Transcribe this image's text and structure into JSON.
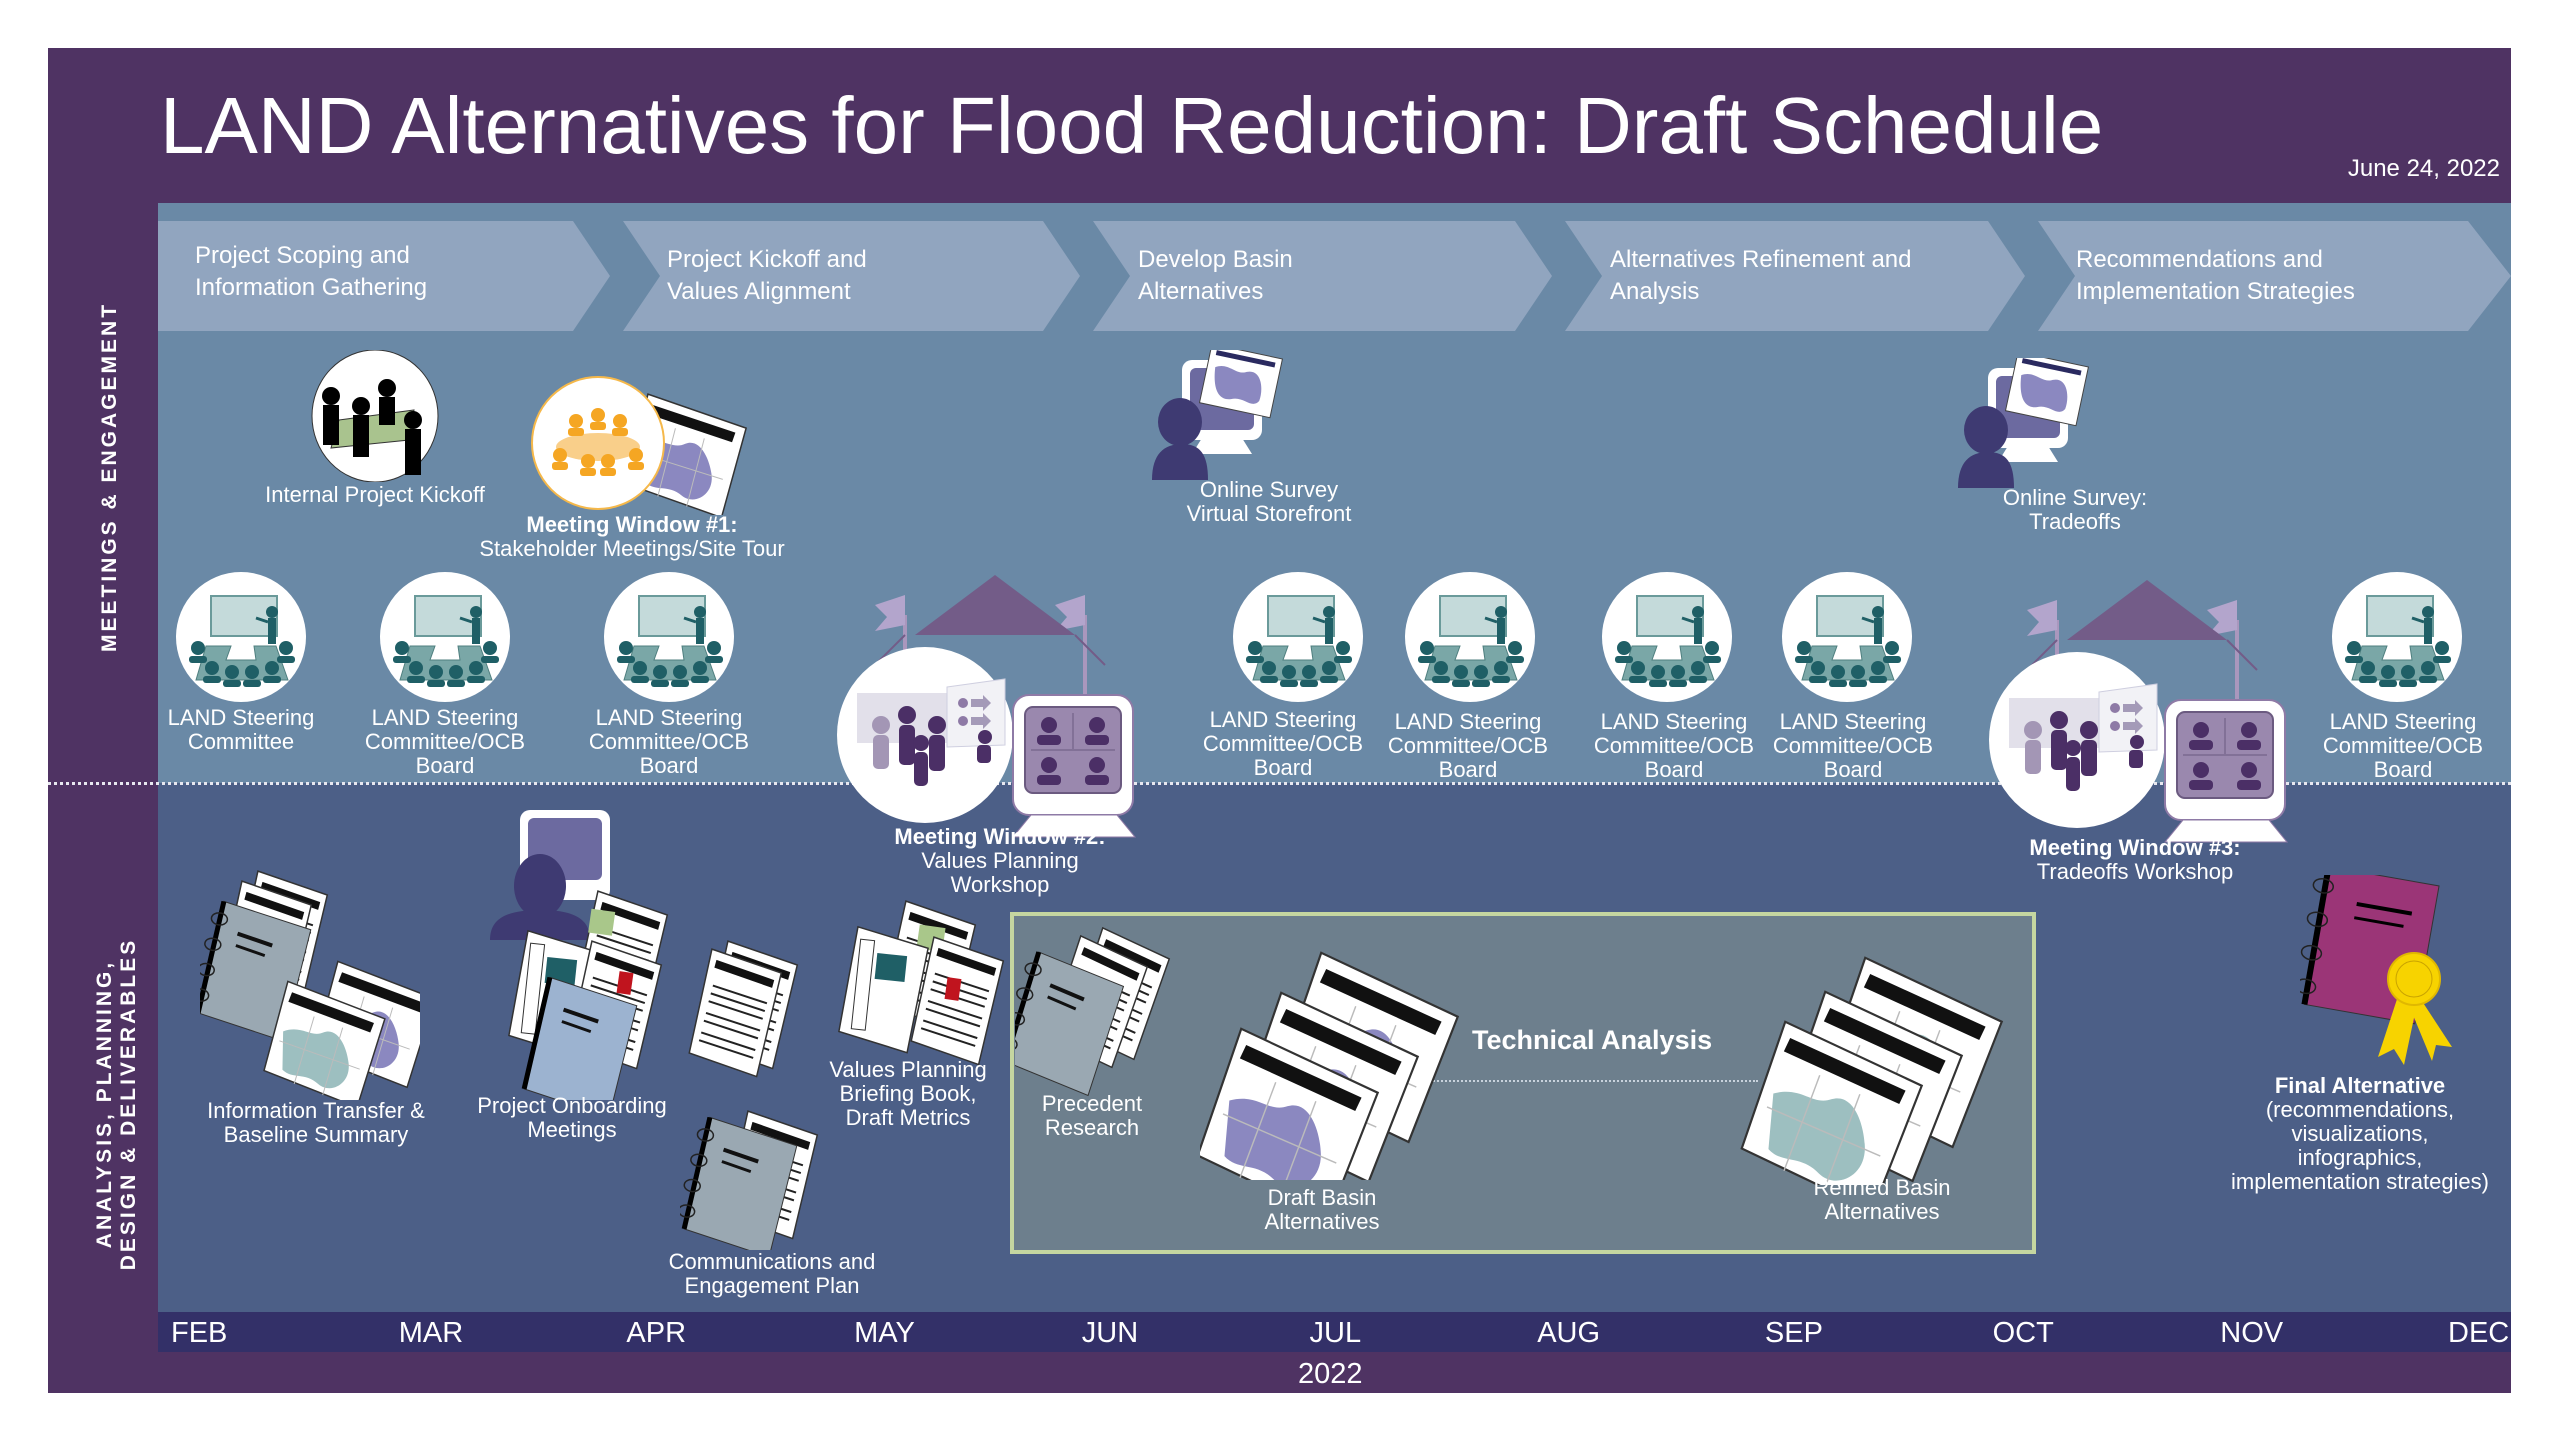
{
  "title": "LAND Alternatives for Flood Reduction: Draft Schedule",
  "date": "June 24, 2022",
  "row_labels": {
    "meetings": "MEETINGS & ENGAGEMENT",
    "analysis_line1": "ANALYSIS, PLANNING,",
    "analysis_line2": "DESIGN & DELIVERABLES"
  },
  "phases": [
    {
      "line1": "Project Scoping and",
      "line2": "Information Gathering"
    },
    {
      "line1": "Project Kickoff and",
      "line2": "Values Alignment"
    },
    {
      "line1": "Develop Basin",
      "line2": "Alternatives"
    },
    {
      "line1": "Alternatives Refinement and",
      "line2": "Analysis"
    },
    {
      "line1": "Recommendations and",
      "line2": "Implementation Strategies"
    }
  ],
  "meetings": {
    "internal_kickoff": "Internal Project Kickoff",
    "window1": {
      "title": "Meeting Window #1:",
      "subtitle": "Stakeholder Meetings/Site Tour"
    },
    "online_survey1": {
      "line1": "Online Survey",
      "line2": "Virtual Storefront"
    },
    "online_survey2": {
      "line1": "Online Survey:",
      "line2": "Tradeoffs"
    },
    "window2": {
      "title": "Meeting Window #2:",
      "line1": "Values Planning",
      "line2": "Workshop"
    },
    "window3": {
      "title": "Meeting Window #3:",
      "line1": "Tradeoffs Workshop"
    },
    "steering": [
      {
        "line1": "LAND Steering",
        "line2": "Committee",
        "line3": ""
      },
      {
        "line1": "LAND Steering",
        "line2": "Committee/OCB",
        "line3": "Board"
      },
      {
        "line1": "LAND Steering",
        "line2": "Committee/OCB",
        "line3": "Board"
      },
      {
        "line1": "LAND Steering",
        "line2": "Committee/OCB",
        "line3": "Board"
      },
      {
        "line1": "LAND Steering",
        "line2": "Committee/OCB",
        "line3": "Board"
      },
      {
        "line1": "LAND Steering",
        "line2": "Committee/OCB",
        "line3": "Board"
      },
      {
        "line1": "LAND Steering",
        "line2": "Committee/OCB",
        "line3": "Board"
      },
      {
        "line1": "LAND Steering",
        "line2": "Committee/OCB",
        "line3": "Board"
      }
    ]
  },
  "deliverables": {
    "info_transfer": {
      "line1": "Information Transfer &",
      "line2": "Baseline Summary"
    },
    "onboarding": {
      "line1": "Project Onboarding",
      "line2": "Meetings"
    },
    "comms_plan": {
      "line1": "Communications and",
      "line2": "Engagement Plan"
    },
    "values_book": {
      "line1": "Values Planning",
      "line2": "Briefing Book,",
      "line3": "Draft Metrics"
    },
    "technical_analysis": "Technical Analysis",
    "precedent": {
      "line1": "Precedent",
      "line2": "Research"
    },
    "draft_basin": {
      "line1": "Draft Basin",
      "line2": "Alternatives"
    },
    "refined_basin": {
      "line1": "Refined Basin",
      "line2": "Alternatives"
    },
    "final": {
      "title": "Final Alternative",
      "line1": "(recommendations,",
      "line2": "visualizations,",
      "line3": "infographics,",
      "line4": "implementation strategies)"
    }
  },
  "timeline": {
    "months": [
      "FEB",
      "MAR",
      "APR",
      "MAY",
      "JUN",
      "JUL",
      "AUG",
      "SEP",
      "OCT",
      "NOV",
      "DEC"
    ],
    "year": "2022"
  },
  "colors": {
    "frame_purple": "#4f3363",
    "meetings_bg": "#6a89a6",
    "analysis_bg": "#4c5f87",
    "phase_chevron": "#91a5bf",
    "month_bar": "#333068",
    "teal_icon": "#1f5f66",
    "orange_icon": "#f5a623",
    "tech_box_border": "#c5d6a0",
    "final_book": "#9b3577",
    "ribbon": "#f7d300"
  }
}
